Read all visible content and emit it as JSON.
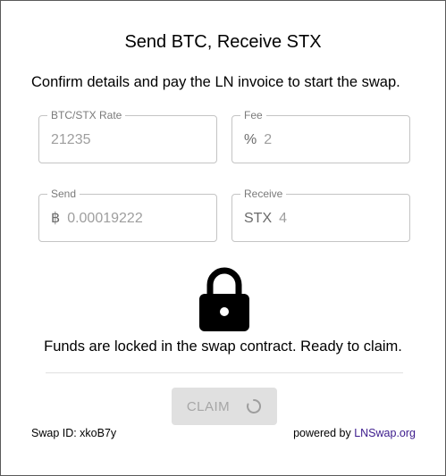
{
  "dialog": {
    "title": "Send BTC, Receive STX",
    "subtitle": "Confirm details and pay the LN invoice to start the swap."
  },
  "fields": {
    "rate": {
      "label": "BTC/STX Rate",
      "prefix": "",
      "value": "21235"
    },
    "fee": {
      "label": "Fee",
      "prefix": "%",
      "value": "2"
    },
    "send": {
      "label": "Send",
      "prefix": "฿",
      "value": "0.00019222"
    },
    "receive": {
      "label": "Receive",
      "prefix": "STX",
      "value": "4"
    }
  },
  "status": {
    "icon": "lock-icon",
    "text": "Funds are locked in the swap contract. Ready to claim."
  },
  "actions": {
    "claim_label": "CLAIM",
    "claim_disabled": true
  },
  "footer": {
    "swap_id_text": "Swap ID: xkoB7y",
    "powered_text": "powered by",
    "powered_link": "LNSwap.org"
  },
  "colors": {
    "link": "#3b1a8c",
    "button_disabled_bg": "#e0e0e0",
    "field_border": "#c4c4c4"
  }
}
